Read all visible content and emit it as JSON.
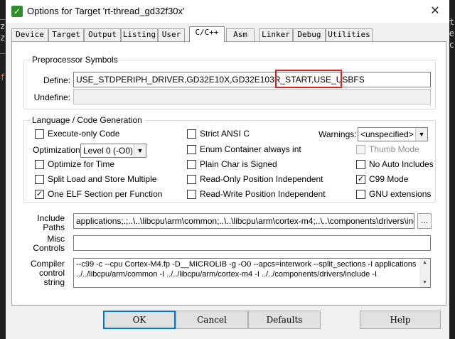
{
  "window": {
    "title": "Options for Target 'rt-thread_gd32f30x'",
    "icon": "check-logo-icon",
    "close": "✕"
  },
  "background": {
    "chars": [
      "_",
      "z",
      "z",
      "_",
      "f"
    ],
    "right_chars": [
      "t",
      "e",
      "c"
    ]
  },
  "tabs": [
    "Device",
    "Target",
    "Output",
    "Listing",
    "User",
    "C/C++",
    "Asm",
    "Linker",
    "Debug",
    "Utilities"
  ],
  "active_tab": "C/C++",
  "preprocessor": {
    "group_label": "Preprocessor Symbols",
    "define_label": "Define:",
    "define_value": "USE_STDPERIPH_DRIVER,GD32E10X,GD32E103R_START,USE_USBFS",
    "undefine_label": "Undefine:",
    "undefine_value": ""
  },
  "language": {
    "group_label": "Language / Code Generation",
    "execute_only": {
      "label": "Execute-only Code",
      "checked": false
    },
    "optimization_label": "Optimization:",
    "optimization_value": "Level 0 (-O0)",
    "optimize_time": {
      "label": "Optimize for Time",
      "checked": false
    },
    "split_load": {
      "label": "Split Load and Store Multiple",
      "checked": false
    },
    "one_elf": {
      "label": "One ELF Section per Function",
      "checked": true
    },
    "strict_ansi": {
      "label": "Strict ANSI C",
      "checked": false
    },
    "enum_container": {
      "label": "Enum Container always int",
      "checked": false
    },
    "plain_char": {
      "label": "Plain Char is Signed",
      "checked": false
    },
    "ro_position": {
      "label": "Read-Only Position Independent",
      "checked": false
    },
    "rw_position": {
      "label": "Read-Write Position Independent",
      "checked": false
    },
    "warnings_label": "Warnings:",
    "warnings_value": "<unspecified>",
    "thumb_mode": {
      "label": "Thumb Mode",
      "checked": false,
      "enabled": false
    },
    "no_auto_includes": {
      "label": "No Auto Includes",
      "checked": false
    },
    "c99_mode": {
      "label": "C99 Mode",
      "checked": true
    },
    "gnu_extensions": {
      "label": "GNU extensions",
      "checked": false
    }
  },
  "include": {
    "label_line1": "Include",
    "label_line2": "Paths",
    "value": "applications;.;..\\..\\libcpu\\arm\\common;..\\..\\libcpu\\arm\\cortex-m4;..\\..\\components\\drivers\\include;..\\",
    "browse": "..."
  },
  "misc": {
    "label_line1": "Misc",
    "label_line2": "Controls",
    "value": ""
  },
  "compiler": {
    "label_line1": "Compiler",
    "label_line2": "control",
    "label_line3": "string",
    "line1": "--c99 -c --cpu Cortex-M4.fp -D__MICROLIB -g -O0 --apcs=interwork --split_sections -I applications -I . -I",
    "line2": "../../libcpu/arm/common -I ../../libcpu/arm/cortex-m4 -I ../../components/drivers/include -I"
  },
  "buttons": {
    "ok": "OK",
    "cancel": "Cancel",
    "defaults": "Defaults",
    "help": "Help"
  },
  "colors": {
    "highlight": "#e02020",
    "accent": "#0078d7"
  }
}
